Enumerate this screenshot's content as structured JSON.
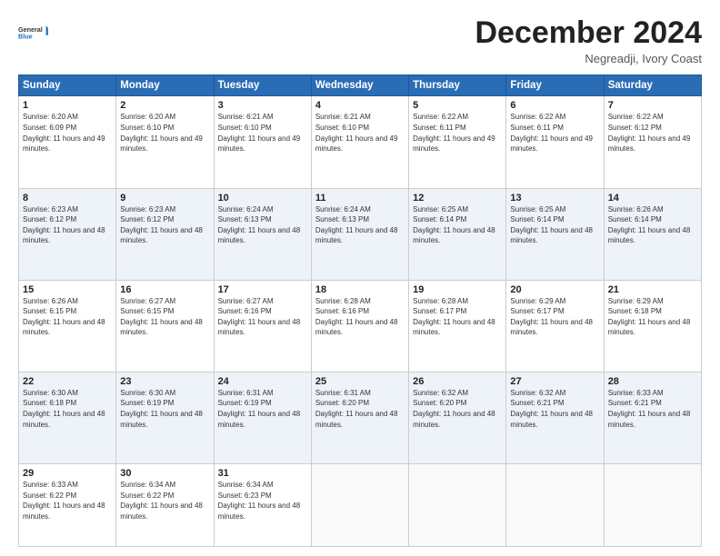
{
  "header": {
    "logo_line1": "General",
    "logo_line2": "Blue",
    "month": "December 2024",
    "location": "Negreadji, Ivory Coast"
  },
  "days_of_week": [
    "Sunday",
    "Monday",
    "Tuesday",
    "Wednesday",
    "Thursday",
    "Friday",
    "Saturday"
  ],
  "weeks": [
    [
      {
        "day": "1",
        "sunrise": "6:20 AM",
        "sunset": "6:09 PM",
        "daylight": "11 hours and 49 minutes."
      },
      {
        "day": "2",
        "sunrise": "6:20 AM",
        "sunset": "6:10 PM",
        "daylight": "11 hours and 49 minutes."
      },
      {
        "day": "3",
        "sunrise": "6:21 AM",
        "sunset": "6:10 PM",
        "daylight": "11 hours and 49 minutes."
      },
      {
        "day": "4",
        "sunrise": "6:21 AM",
        "sunset": "6:10 PM",
        "daylight": "11 hours and 49 minutes."
      },
      {
        "day": "5",
        "sunrise": "6:22 AM",
        "sunset": "6:11 PM",
        "daylight": "11 hours and 49 minutes."
      },
      {
        "day": "6",
        "sunrise": "6:22 AM",
        "sunset": "6:11 PM",
        "daylight": "11 hours and 49 minutes."
      },
      {
        "day": "7",
        "sunrise": "6:22 AM",
        "sunset": "6:12 PM",
        "daylight": "11 hours and 49 minutes."
      }
    ],
    [
      {
        "day": "8",
        "sunrise": "6:23 AM",
        "sunset": "6:12 PM",
        "daylight": "11 hours and 48 minutes."
      },
      {
        "day": "9",
        "sunrise": "6:23 AM",
        "sunset": "6:12 PM",
        "daylight": "11 hours and 48 minutes."
      },
      {
        "day": "10",
        "sunrise": "6:24 AM",
        "sunset": "6:13 PM",
        "daylight": "11 hours and 48 minutes."
      },
      {
        "day": "11",
        "sunrise": "6:24 AM",
        "sunset": "6:13 PM",
        "daylight": "11 hours and 48 minutes."
      },
      {
        "day": "12",
        "sunrise": "6:25 AM",
        "sunset": "6:14 PM",
        "daylight": "11 hours and 48 minutes."
      },
      {
        "day": "13",
        "sunrise": "6:25 AM",
        "sunset": "6:14 PM",
        "daylight": "11 hours and 48 minutes."
      },
      {
        "day": "14",
        "sunrise": "6:26 AM",
        "sunset": "6:14 PM",
        "daylight": "11 hours and 48 minutes."
      }
    ],
    [
      {
        "day": "15",
        "sunrise": "6:26 AM",
        "sunset": "6:15 PM",
        "daylight": "11 hours and 48 minutes."
      },
      {
        "day": "16",
        "sunrise": "6:27 AM",
        "sunset": "6:15 PM",
        "daylight": "11 hours and 48 minutes."
      },
      {
        "day": "17",
        "sunrise": "6:27 AM",
        "sunset": "6:16 PM",
        "daylight": "11 hours and 48 minutes."
      },
      {
        "day": "18",
        "sunrise": "6:28 AM",
        "sunset": "6:16 PM",
        "daylight": "11 hours and 48 minutes."
      },
      {
        "day": "19",
        "sunrise": "6:28 AM",
        "sunset": "6:17 PM",
        "daylight": "11 hours and 48 minutes."
      },
      {
        "day": "20",
        "sunrise": "6:29 AM",
        "sunset": "6:17 PM",
        "daylight": "11 hours and 48 minutes."
      },
      {
        "day": "21",
        "sunrise": "6:29 AM",
        "sunset": "6:18 PM",
        "daylight": "11 hours and 48 minutes."
      }
    ],
    [
      {
        "day": "22",
        "sunrise": "6:30 AM",
        "sunset": "6:18 PM",
        "daylight": "11 hours and 48 minutes."
      },
      {
        "day": "23",
        "sunrise": "6:30 AM",
        "sunset": "6:19 PM",
        "daylight": "11 hours and 48 minutes."
      },
      {
        "day": "24",
        "sunrise": "6:31 AM",
        "sunset": "6:19 PM",
        "daylight": "11 hours and 48 minutes."
      },
      {
        "day": "25",
        "sunrise": "6:31 AM",
        "sunset": "6:20 PM",
        "daylight": "11 hours and 48 minutes."
      },
      {
        "day": "26",
        "sunrise": "6:32 AM",
        "sunset": "6:20 PM",
        "daylight": "11 hours and 48 minutes."
      },
      {
        "day": "27",
        "sunrise": "6:32 AM",
        "sunset": "6:21 PM",
        "daylight": "11 hours and 48 minutes."
      },
      {
        "day": "28",
        "sunrise": "6:33 AM",
        "sunset": "6:21 PM",
        "daylight": "11 hours and 48 minutes."
      }
    ],
    [
      {
        "day": "29",
        "sunrise": "6:33 AM",
        "sunset": "6:22 PM",
        "daylight": "11 hours and 48 minutes."
      },
      {
        "day": "30",
        "sunrise": "6:34 AM",
        "sunset": "6:22 PM",
        "daylight": "11 hours and 48 minutes."
      },
      {
        "day": "31",
        "sunrise": "6:34 AM",
        "sunset": "6:23 PM",
        "daylight": "11 hours and 48 minutes."
      },
      null,
      null,
      null,
      null
    ]
  ]
}
